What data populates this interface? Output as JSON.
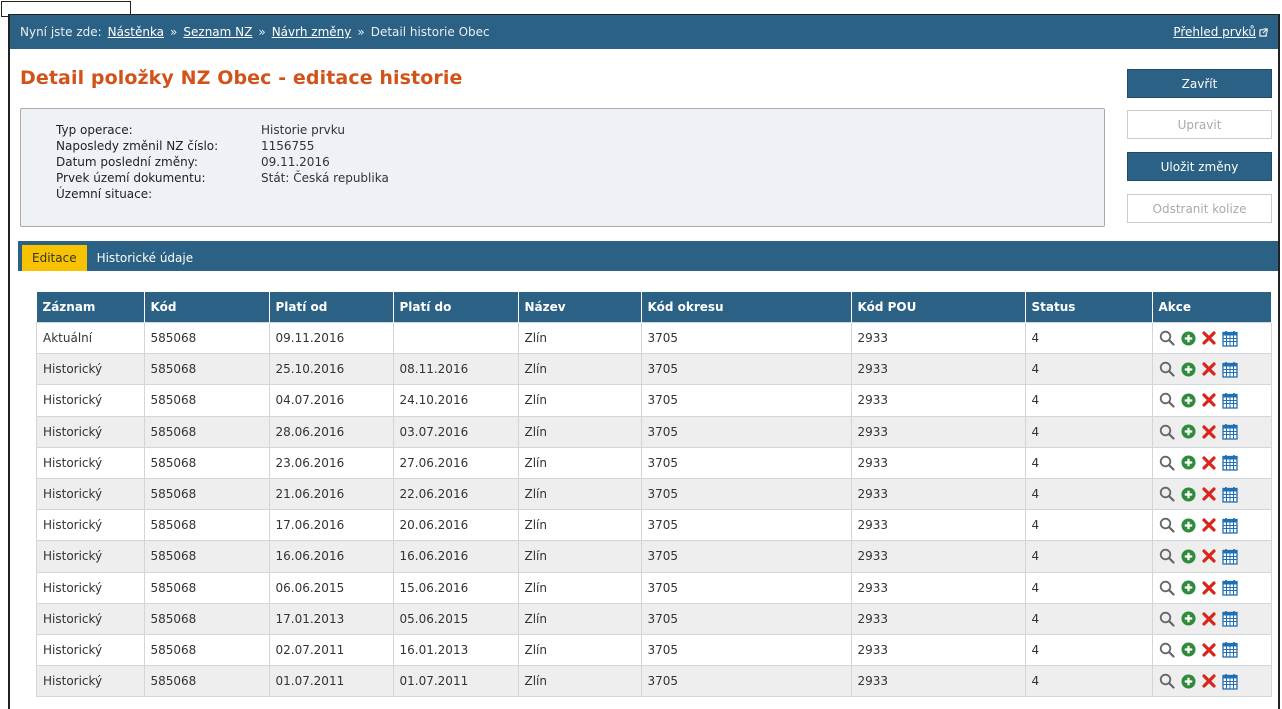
{
  "breadcrumb": {
    "prefix": "Nyní jste zde:",
    "links": [
      "Nástěnka",
      "Seznam NZ",
      "Návrh změny"
    ],
    "current": "Detail historie Obec",
    "separator": "»"
  },
  "overview_link": "Přehled prvků",
  "page_title": "Detail položky NZ Obec - editace historie",
  "info": [
    {
      "label": "Typ operace:",
      "value": "Historie prvku"
    },
    {
      "label": "Naposledy změnil NZ číslo:",
      "value": "1156755"
    },
    {
      "label": "Datum poslední změny:",
      "value": "09.11.2016"
    },
    {
      "label": "Prvek území dokumentu:",
      "value": "Stát: Česká republika"
    },
    {
      "label": "Územní situace:",
      "value": ""
    }
  ],
  "buttons": {
    "close": "Zavřít",
    "edit": "Upravit",
    "save": "Uložit změny",
    "remove_conflicts": "Odstranit kolize"
  },
  "tabs": [
    {
      "label": "Editace",
      "active": true
    },
    {
      "label": "Historické údaje",
      "active": false
    }
  ],
  "table": {
    "headers": [
      "Záznam",
      "Kód",
      "Platí od",
      "Platí do",
      "Název",
      "Kód okresu",
      "Kód POU",
      "Status",
      "Akce"
    ],
    "rows": [
      [
        "Aktuální",
        "585068",
        "09.11.2016",
        "",
        "Zlín",
        "3705",
        "2933",
        "4"
      ],
      [
        "Historický",
        "585068",
        "25.10.2016",
        "08.11.2016",
        "Zlín",
        "3705",
        "2933",
        "4"
      ],
      [
        "Historický",
        "585068",
        "04.07.2016",
        "24.10.2016",
        "Zlín",
        "3705",
        "2933",
        "4"
      ],
      [
        "Historický",
        "585068",
        "28.06.2016",
        "03.07.2016",
        "Zlín",
        "3705",
        "2933",
        "4"
      ],
      [
        "Historický",
        "585068",
        "23.06.2016",
        "27.06.2016",
        "Zlín",
        "3705",
        "2933",
        "4"
      ],
      [
        "Historický",
        "585068",
        "21.06.2016",
        "22.06.2016",
        "Zlín",
        "3705",
        "2933",
        "4"
      ],
      [
        "Historický",
        "585068",
        "17.06.2016",
        "20.06.2016",
        "Zlín",
        "3705",
        "2933",
        "4"
      ],
      [
        "Historický",
        "585068",
        "16.06.2016",
        "16.06.2016",
        "Zlín",
        "3705",
        "2933",
        "4"
      ],
      [
        "Historický",
        "585068",
        "06.06.2015",
        "15.06.2016",
        "Zlín",
        "3705",
        "2933",
        "4"
      ],
      [
        "Historický",
        "585068",
        "17.01.2013",
        "05.06.2015",
        "Zlín",
        "3705",
        "2933",
        "4"
      ],
      [
        "Historický",
        "585068",
        "02.07.2011",
        "16.01.2013",
        "Zlín",
        "3705",
        "2933",
        "4"
      ],
      [
        "Historický",
        "585068",
        "01.07.2011",
        "01.07.2011",
        "Zlín",
        "3705",
        "2933",
        "4"
      ]
    ],
    "action_icons": [
      "search-icon",
      "add-circle-icon",
      "delete-x-icon",
      "calendar-icon"
    ]
  },
  "colors": {
    "header_blue": "#2b6185",
    "title_orange": "#d2531a",
    "tab_active_yellow": "#f7c300",
    "add_green": "#2e8b3a",
    "delete_red": "#d9261c",
    "calendar_blue": "#1f6fb2"
  }
}
